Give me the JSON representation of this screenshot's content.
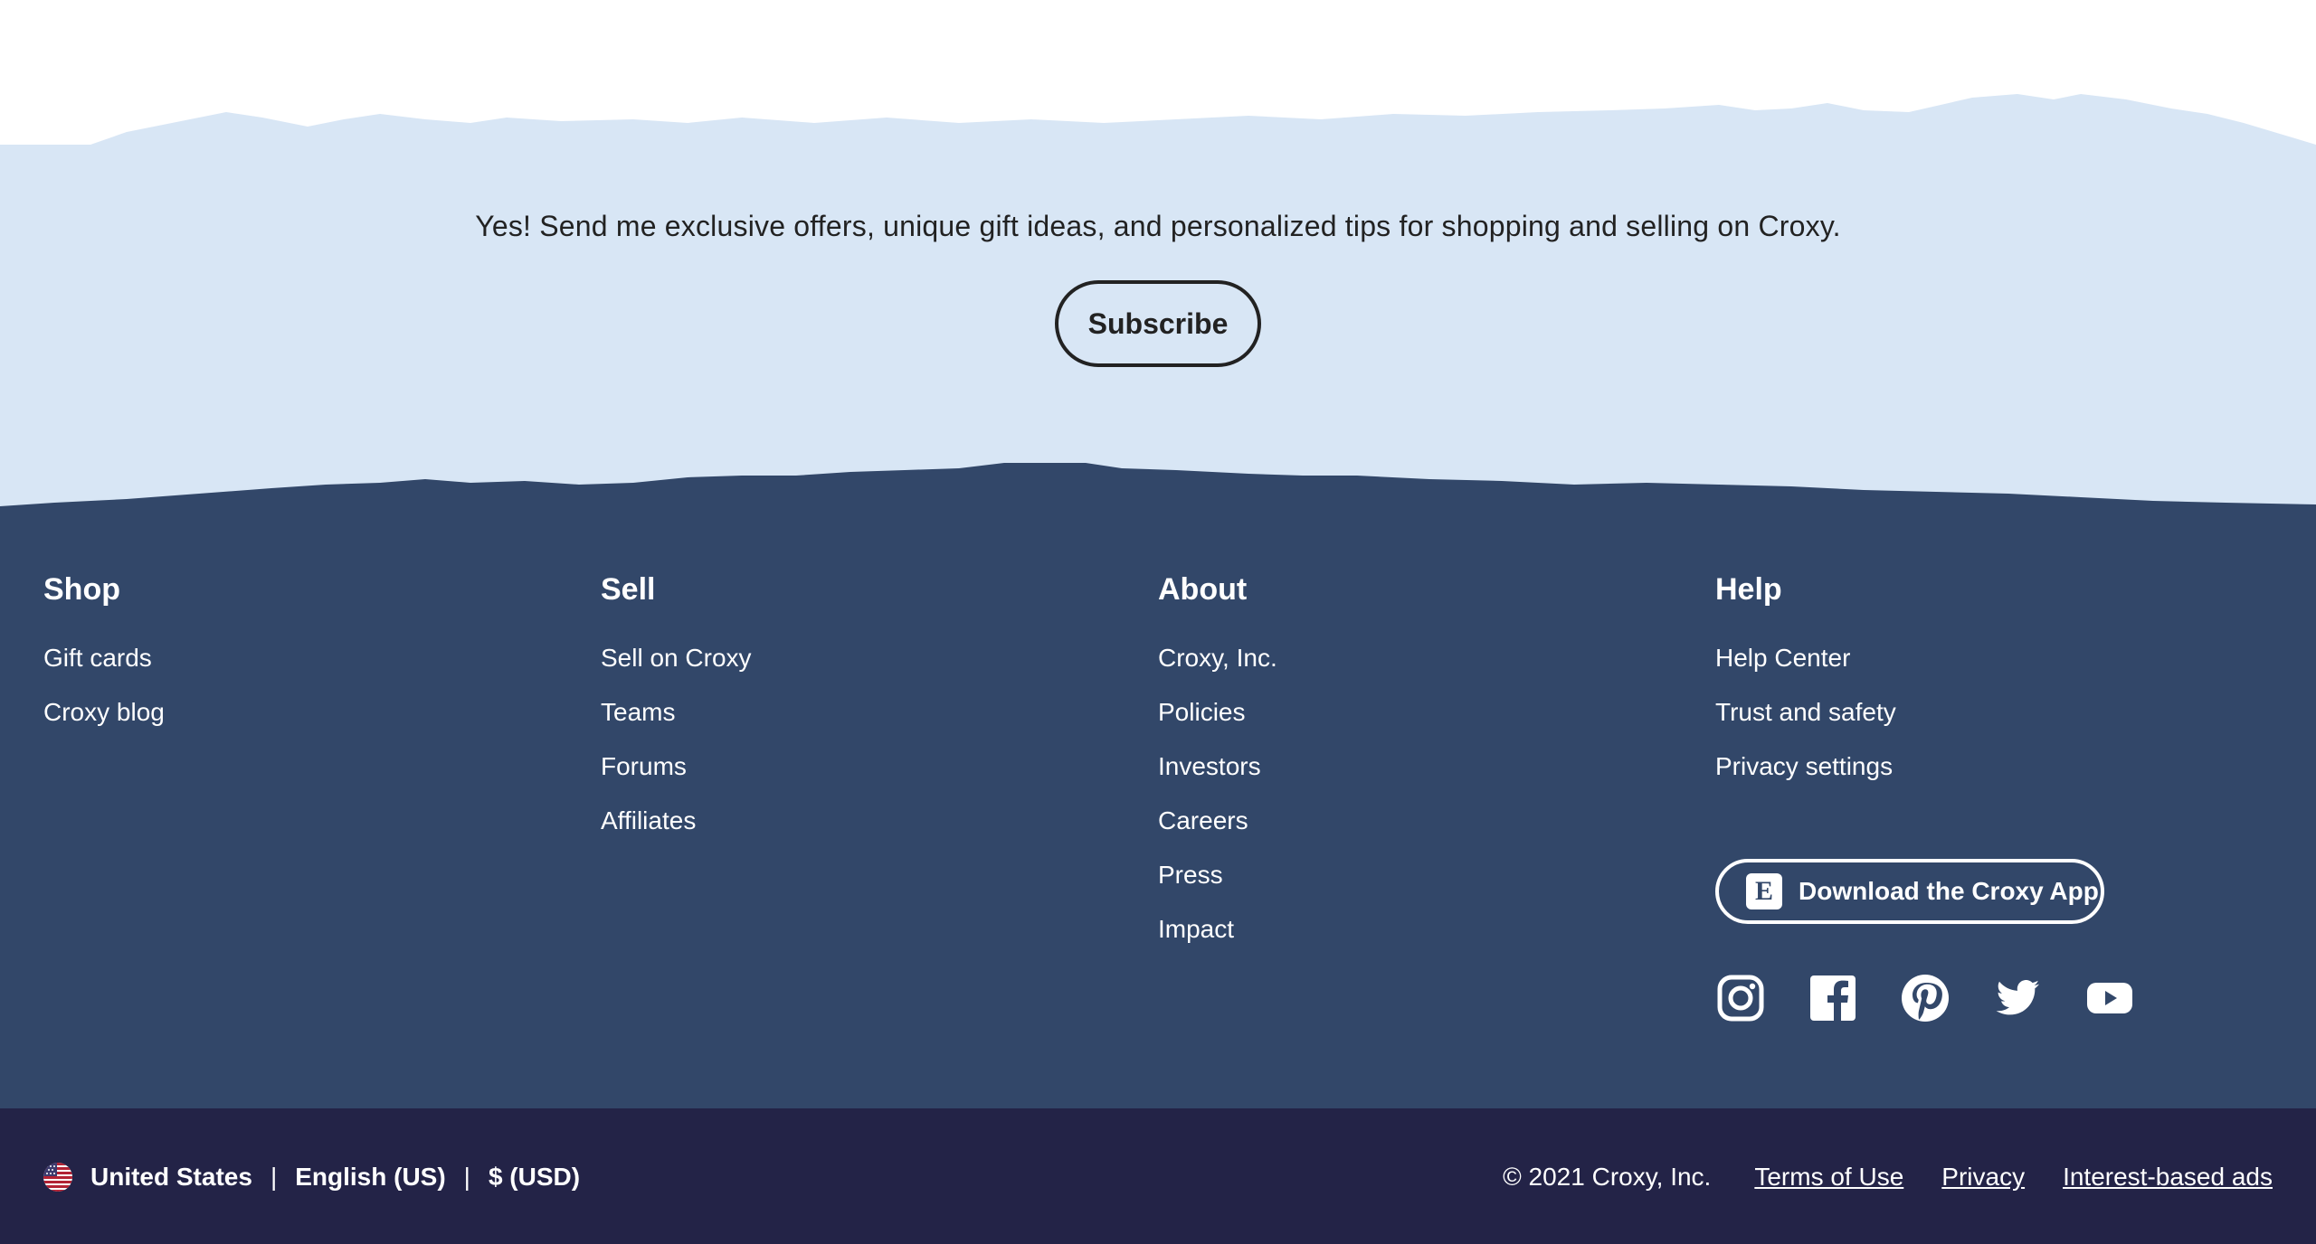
{
  "newsletter": {
    "text": "Yes! Send me exclusive offers, unique gift ideas, and personalized tips for shopping and selling on Croxy.",
    "subscribe_label": "Subscribe"
  },
  "footer": {
    "columns": [
      {
        "heading": "Shop",
        "links": [
          "Gift cards",
          "Croxy blog"
        ]
      },
      {
        "heading": "Sell",
        "links": [
          "Sell on Croxy",
          "Teams",
          "Forums",
          "Affiliates"
        ]
      },
      {
        "heading": "About",
        "links": [
          "Croxy, Inc.",
          "Policies",
          "Investors",
          "Careers",
          "Press",
          "Impact"
        ]
      },
      {
        "heading": "Help",
        "links": [
          "Help Center",
          "Trust and safety",
          "Privacy settings"
        ]
      }
    ],
    "app_button": {
      "icon_letter": "E",
      "label": "Download the Croxy App"
    },
    "socials": [
      "instagram-icon",
      "facebook-icon",
      "pinterest-icon",
      "twitter-icon",
      "youtube-icon"
    ]
  },
  "bottom_bar": {
    "country": "United States",
    "language": "English (US)",
    "currency": "$ (USD)",
    "separator": "|",
    "copyright": "© 2021 Croxy, Inc.",
    "links": [
      "Terms of Use",
      "Privacy",
      "Interest-based ads"
    ]
  },
  "colors": {
    "newsletter_bg": "#d8e6f5",
    "footer_bg": "#324769",
    "bottom_bar_bg": "#232347",
    "text_dark": "#222222",
    "text_light": "#ffffff"
  }
}
